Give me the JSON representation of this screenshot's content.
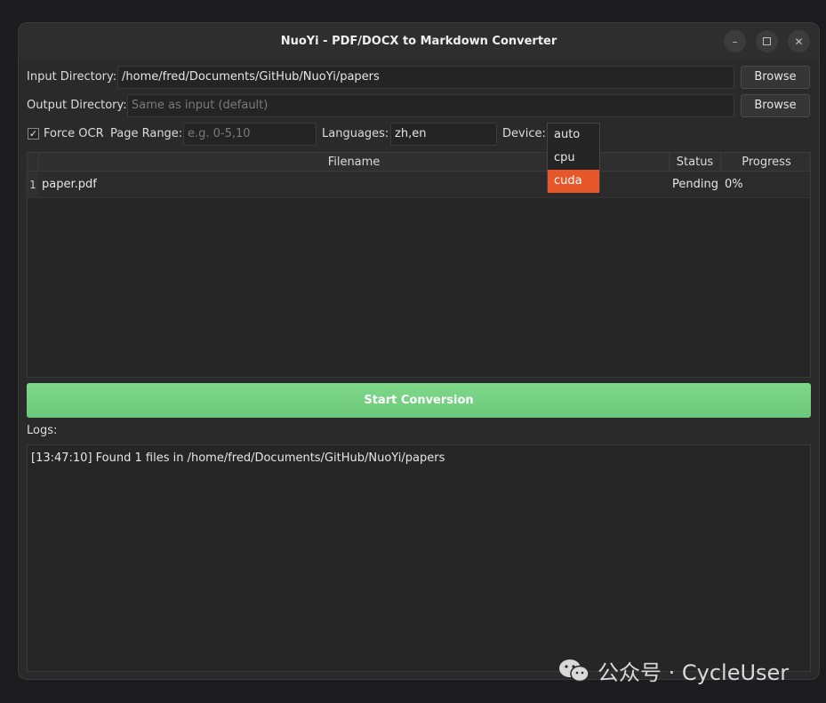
{
  "window": {
    "title": "NuoYi - PDF/DOCX to Markdown Converter",
    "buttons": [
      "minimize",
      "maximize",
      "close"
    ]
  },
  "input_dir": {
    "label": "Input Directory:",
    "value": "/home/fred/Documents/GitHub/NuoYi/papers",
    "browse": "Browse"
  },
  "output_dir": {
    "label": "Output Directory:",
    "placeholder": "Same as input (default)",
    "browse": "Browse"
  },
  "options": {
    "force_ocr": {
      "label": "Force OCR",
      "checked": true,
      "mark": "✓"
    },
    "page_range": {
      "label": "Page Range:",
      "placeholder": "e.g. 0-5,10"
    },
    "languages": {
      "label": "Languages:",
      "value": "zh,en"
    },
    "device": {
      "label": "Device:",
      "options": [
        "auto",
        "cpu",
        "cuda"
      ],
      "highlighted": "cuda"
    }
  },
  "table": {
    "columns": [
      "Filename",
      "Status",
      "Progress"
    ],
    "rows": [
      {
        "num": "1",
        "filename": "paper.pdf",
        "status": "Pending",
        "progress": "0%"
      }
    ]
  },
  "start_button": "Start Conversion",
  "logs": {
    "label": "Logs:",
    "lines": [
      "[13:47:10] Found 1 files in /home/fred/Documents/GitHub/NuoYi/papers"
    ]
  },
  "watermark": {
    "text": "公众号 · CycleUser",
    "icon": "wechat-icon"
  },
  "colors": {
    "accent": "#e8572a",
    "start": "#74cf81",
    "background": "#2a2a2a"
  }
}
